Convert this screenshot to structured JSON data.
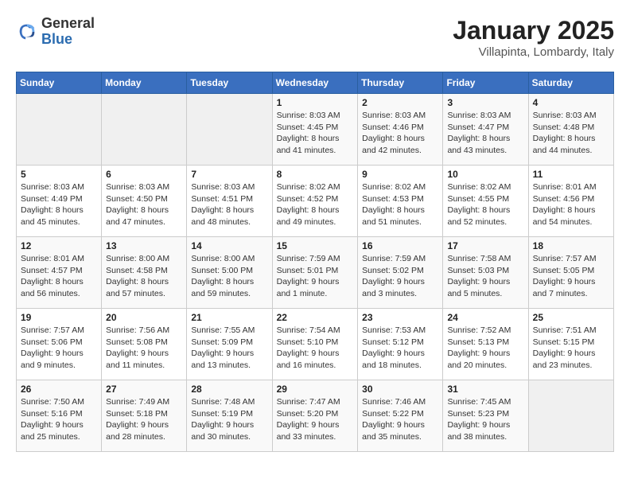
{
  "logo": {
    "general": "General",
    "blue": "Blue"
  },
  "header": {
    "title": "January 2025",
    "location": "Villapinta, Lombardy, Italy"
  },
  "weekdays": [
    "Sunday",
    "Monday",
    "Tuesday",
    "Wednesday",
    "Thursday",
    "Friday",
    "Saturday"
  ],
  "weeks": [
    [
      {
        "day": "",
        "info": ""
      },
      {
        "day": "",
        "info": ""
      },
      {
        "day": "",
        "info": ""
      },
      {
        "day": "1",
        "info": "Sunrise: 8:03 AM\nSunset: 4:45 PM\nDaylight: 8 hours and 41 minutes."
      },
      {
        "day": "2",
        "info": "Sunrise: 8:03 AM\nSunset: 4:46 PM\nDaylight: 8 hours and 42 minutes."
      },
      {
        "day": "3",
        "info": "Sunrise: 8:03 AM\nSunset: 4:47 PM\nDaylight: 8 hours and 43 minutes."
      },
      {
        "day": "4",
        "info": "Sunrise: 8:03 AM\nSunset: 4:48 PM\nDaylight: 8 hours and 44 minutes."
      }
    ],
    [
      {
        "day": "5",
        "info": "Sunrise: 8:03 AM\nSunset: 4:49 PM\nDaylight: 8 hours and 45 minutes."
      },
      {
        "day": "6",
        "info": "Sunrise: 8:03 AM\nSunset: 4:50 PM\nDaylight: 8 hours and 47 minutes."
      },
      {
        "day": "7",
        "info": "Sunrise: 8:03 AM\nSunset: 4:51 PM\nDaylight: 8 hours and 48 minutes."
      },
      {
        "day": "8",
        "info": "Sunrise: 8:02 AM\nSunset: 4:52 PM\nDaylight: 8 hours and 49 minutes."
      },
      {
        "day": "9",
        "info": "Sunrise: 8:02 AM\nSunset: 4:53 PM\nDaylight: 8 hours and 51 minutes."
      },
      {
        "day": "10",
        "info": "Sunrise: 8:02 AM\nSunset: 4:55 PM\nDaylight: 8 hours and 52 minutes."
      },
      {
        "day": "11",
        "info": "Sunrise: 8:01 AM\nSunset: 4:56 PM\nDaylight: 8 hours and 54 minutes."
      }
    ],
    [
      {
        "day": "12",
        "info": "Sunrise: 8:01 AM\nSunset: 4:57 PM\nDaylight: 8 hours and 56 minutes."
      },
      {
        "day": "13",
        "info": "Sunrise: 8:00 AM\nSunset: 4:58 PM\nDaylight: 8 hours and 57 minutes."
      },
      {
        "day": "14",
        "info": "Sunrise: 8:00 AM\nSunset: 5:00 PM\nDaylight: 8 hours and 59 minutes."
      },
      {
        "day": "15",
        "info": "Sunrise: 7:59 AM\nSunset: 5:01 PM\nDaylight: 9 hours and 1 minute."
      },
      {
        "day": "16",
        "info": "Sunrise: 7:59 AM\nSunset: 5:02 PM\nDaylight: 9 hours and 3 minutes."
      },
      {
        "day": "17",
        "info": "Sunrise: 7:58 AM\nSunset: 5:03 PM\nDaylight: 9 hours and 5 minutes."
      },
      {
        "day": "18",
        "info": "Sunrise: 7:57 AM\nSunset: 5:05 PM\nDaylight: 9 hours and 7 minutes."
      }
    ],
    [
      {
        "day": "19",
        "info": "Sunrise: 7:57 AM\nSunset: 5:06 PM\nDaylight: 9 hours and 9 minutes."
      },
      {
        "day": "20",
        "info": "Sunrise: 7:56 AM\nSunset: 5:08 PM\nDaylight: 9 hours and 11 minutes."
      },
      {
        "day": "21",
        "info": "Sunrise: 7:55 AM\nSunset: 5:09 PM\nDaylight: 9 hours and 13 minutes."
      },
      {
        "day": "22",
        "info": "Sunrise: 7:54 AM\nSunset: 5:10 PM\nDaylight: 9 hours and 16 minutes."
      },
      {
        "day": "23",
        "info": "Sunrise: 7:53 AM\nSunset: 5:12 PM\nDaylight: 9 hours and 18 minutes."
      },
      {
        "day": "24",
        "info": "Sunrise: 7:52 AM\nSunset: 5:13 PM\nDaylight: 9 hours and 20 minutes."
      },
      {
        "day": "25",
        "info": "Sunrise: 7:51 AM\nSunset: 5:15 PM\nDaylight: 9 hours and 23 minutes."
      }
    ],
    [
      {
        "day": "26",
        "info": "Sunrise: 7:50 AM\nSunset: 5:16 PM\nDaylight: 9 hours and 25 minutes."
      },
      {
        "day": "27",
        "info": "Sunrise: 7:49 AM\nSunset: 5:18 PM\nDaylight: 9 hours and 28 minutes."
      },
      {
        "day": "28",
        "info": "Sunrise: 7:48 AM\nSunset: 5:19 PM\nDaylight: 9 hours and 30 minutes."
      },
      {
        "day": "29",
        "info": "Sunrise: 7:47 AM\nSunset: 5:20 PM\nDaylight: 9 hours and 33 minutes."
      },
      {
        "day": "30",
        "info": "Sunrise: 7:46 AM\nSunset: 5:22 PM\nDaylight: 9 hours and 35 minutes."
      },
      {
        "day": "31",
        "info": "Sunrise: 7:45 AM\nSunset: 5:23 PM\nDaylight: 9 hours and 38 minutes."
      },
      {
        "day": "",
        "info": ""
      }
    ]
  ]
}
